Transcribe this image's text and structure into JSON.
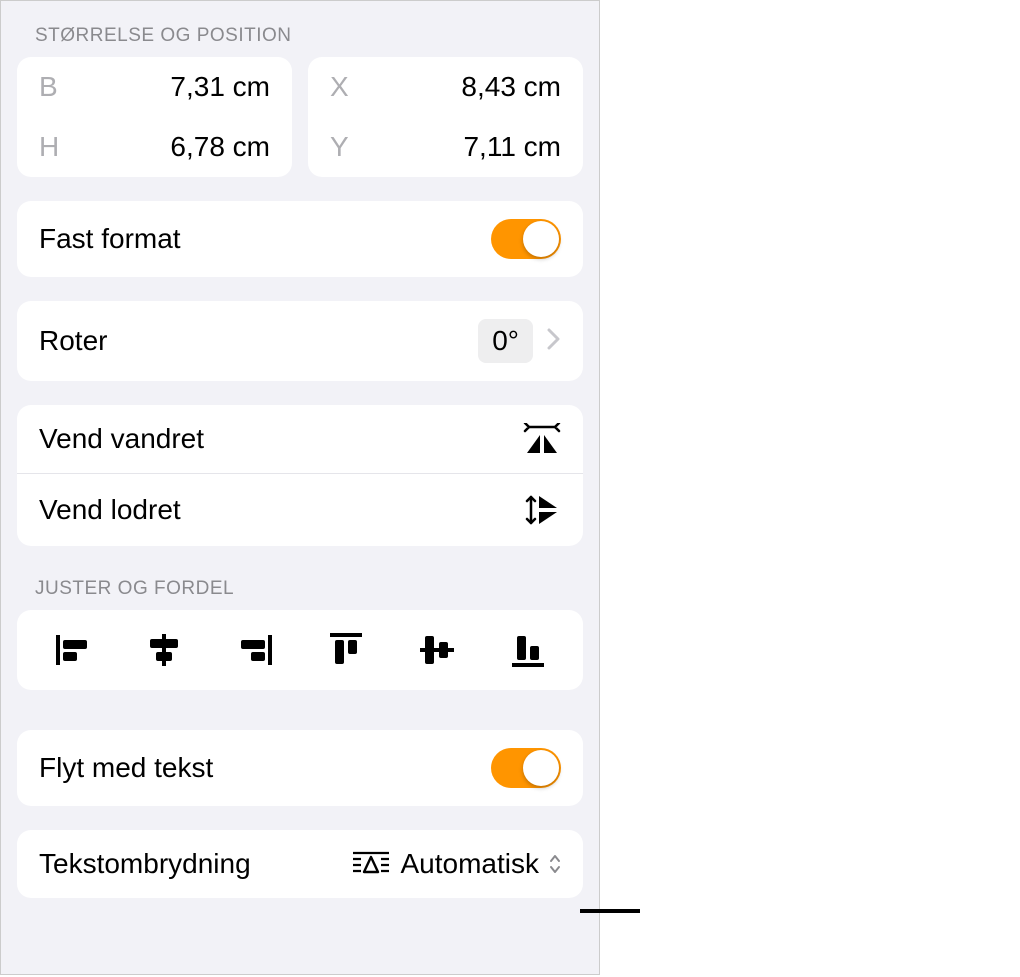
{
  "size_position": {
    "header": "STØRRELSE OG POSITION",
    "width_label": "B",
    "width_value": "7,31 cm",
    "height_label": "H",
    "height_value": "6,78 cm",
    "x_label": "X",
    "x_value": "8,43 cm",
    "y_label": "Y",
    "y_value": "7,11 cm"
  },
  "constrain": {
    "label": "Fast format",
    "enabled": true
  },
  "rotate": {
    "label": "Roter",
    "value": "0°"
  },
  "flip": {
    "horizontal": "Vend vandret",
    "vertical": "Vend lodret"
  },
  "align_distribute": {
    "header": "JUSTER OG FORDEL",
    "buttons": [
      "align-left",
      "align-center-h",
      "align-right",
      "align-top",
      "align-center-v",
      "align-bottom"
    ]
  },
  "move_with_text": {
    "label": "Flyt med tekst",
    "enabled": true
  },
  "text_wrap": {
    "label": "Tekstombrydning",
    "value": "Automatisk"
  },
  "colors": {
    "accent": "#ff9500"
  }
}
